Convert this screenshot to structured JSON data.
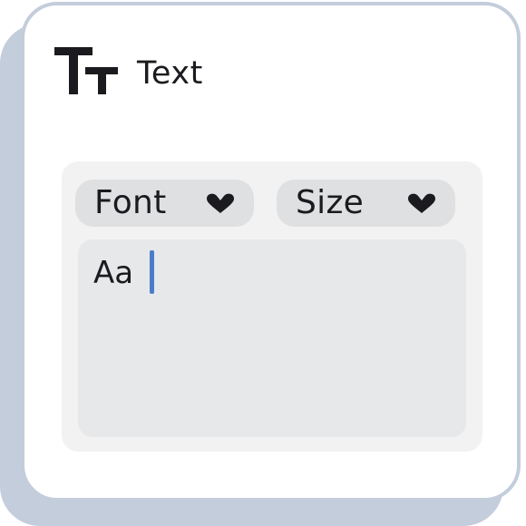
{
  "header": {
    "title": "Text",
    "icon": "text-size-icon"
  },
  "controls": {
    "font_dropdown": {
      "label": "Font",
      "icon": "chevron-down-icon"
    },
    "size_dropdown": {
      "label": "Size",
      "icon": "chevron-down-icon"
    }
  },
  "editor": {
    "value": "Aa",
    "caret_color": "#4a7cc9"
  },
  "colors": {
    "frame": "#c3cddb",
    "panel": "#f2f2f2",
    "dropdown": "#dfe0e2",
    "editor": "#e7e8ea",
    "ink": "#1b1b1f"
  }
}
